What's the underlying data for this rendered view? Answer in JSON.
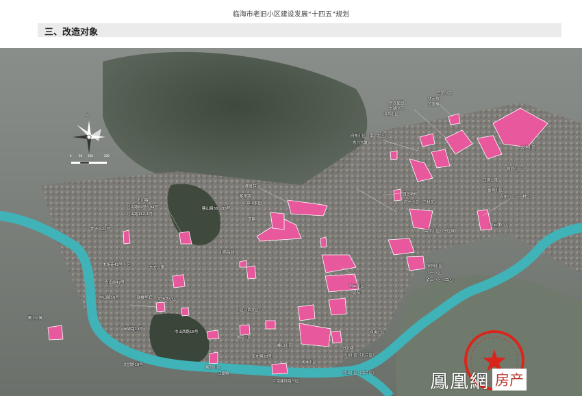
{
  "document": {
    "title": "临海市老旧小区建设发展“十四五”规划",
    "section_title": "三、改造对象"
  },
  "map": {
    "highlight_color": "#e8589c",
    "river_color": "#3fb3b7",
    "stamp_color": "#d9261c",
    "icons": [
      "north-arrow-icon",
      "scale-bar",
      "official-seal-icon",
      "star-icon"
    ],
    "scale_labels": [
      "0",
      "50",
      "100",
      "200"
    ],
    "north_label": "N",
    "labels": [
      {
        "id": "zhuangyuan",
        "text": "状元坊"
      },
      {
        "id": "donghu",
        "text": "东湖小区"
      },
      {
        "id": "sanzheng",
        "text": "三正小区"
      },
      {
        "id": "yunfu",
        "text": "云富楼"
      },
      {
        "id": "dongfang",
        "text": "东方星园"
      },
      {
        "id": "hexi",
        "text": "河西小区"
      },
      {
        "id": "fudong",
        "text": "府东小区（南、北区）"
      },
      {
        "id": "dongxing",
        "text": "东兴大厦"
      },
      {
        "id": "dayang",
        "text": "大洋小区"
      },
      {
        "id": "ganyuan",
        "text": "赣园小区"
      },
      {
        "id": "jiangbin",
        "text": "江滨公寓"
      },
      {
        "id": "fuyuan",
        "text": "富源小区"
      },
      {
        "id": "yuanyi",
        "text": "园艺新村"
      },
      {
        "id": "fudong3",
        "text": "府东小区（三村区）"
      },
      {
        "id": "fudong1",
        "text": "府东小区（一村区）"
      },
      {
        "id": "gaoqiao",
        "text": "高桥小区（一区域）"
      },
      {
        "id": "shuiyun",
        "text": "水云律小区"
      },
      {
        "id": "beishanlu_a",
        "text": "北山路84号~94号"
      },
      {
        "id": "beishanlu_b",
        "text": "北山路112-1号"
      },
      {
        "id": "shangshan",
        "text": "上山路"
      },
      {
        "id": "jiuluo",
        "text": "糖山路36、38号"
      },
      {
        "id": "ziyang",
        "text": "紫阳路"
      },
      {
        "id": "jinshan",
        "text": "锦山家园"
      },
      {
        "id": "lujing",
        "text": "鹿景苑"
      },
      {
        "id": "daolu",
        "text": "道路"
      },
      {
        "id": "mengtian",
        "text": "梦天台22号"
      },
      {
        "id": "muchangxiang",
        "text": "木场巷42号小区"
      },
      {
        "id": "dongfang_gong",
        "text": "东方公寓"
      },
      {
        "id": "dongshan",
        "text": "东山前47号"
      },
      {
        "id": "xiaoshang",
        "text": "小商品城"
      },
      {
        "id": "zhongshan_a",
        "text": "中山路16号"
      },
      {
        "id": "gulou",
        "text": "鼓楼华庭"
      },
      {
        "id": "wenjiang",
        "text": "文扬坊小区"
      },
      {
        "id": "chicheng",
        "text": "赤城路13号"
      },
      {
        "id": "zhongshan_b",
        "text": "巾山西路18号"
      },
      {
        "id": "beigu",
        "text": "北固路19号"
      },
      {
        "id": "ziyuan",
        "text": "紫园小区"
      },
      {
        "id": "xiaoqu_south",
        "text": "小区（西北区）"
      },
      {
        "id": "chengnan",
        "text": "城南二区"
      },
      {
        "id": "baiyun",
        "text": "白云小区"
      },
      {
        "id": "tingyuan",
        "text": "庭院"
      },
      {
        "id": "wangjiang",
        "text": "望江小区（二区）"
      },
      {
        "id": "anyang",
        "text": "安阳小区"
      },
      {
        "id": "bayi",
        "text": "八一小区"
      },
      {
        "id": "lianjiang",
        "text": "溧江公寓"
      },
      {
        "id": "jiangxia",
        "text": "江夏路"
      },
      {
        "id": "shuang",
        "text": "双溪小区"
      },
      {
        "id": "jiangnan",
        "text": "江南建设路三区"
      },
      {
        "id": "pengzhuang",
        "text": "彭庄路20号"
      },
      {
        "id": "baiyunlu",
        "text": "白云路"
      },
      {
        "id": "zhongshan_c",
        "text": "巾山小区（北片区）"
      },
      {
        "id": "zhongshan_d",
        "text": "巾山小区（南片区）"
      },
      {
        "id": "fengshan",
        "text": "峰山小区"
      },
      {
        "id": "xigang",
        "text": "溪港小区"
      }
    ],
    "watermark": {
      "main": "鳳凰網",
      "tag": "房产"
    }
  }
}
